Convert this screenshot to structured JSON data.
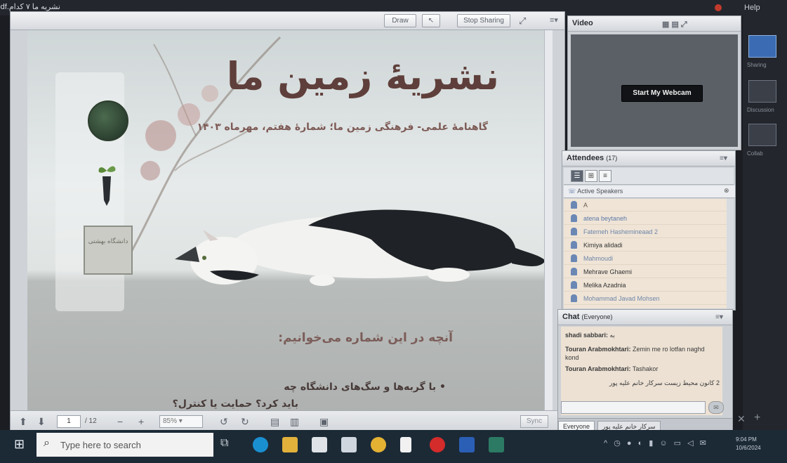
{
  "window": {
    "doc_title": "pdf.نشریه ما ۷ کدام",
    "help": "Help"
  },
  "share": {
    "draw": "Draw",
    "stop_sharing": "Stop Sharing",
    "page_current": "1",
    "page_total": "/ 12",
    "zoom": "85%",
    "sync": "Sync"
  },
  "slide": {
    "title": "نشریهٔ زمین ما",
    "subtitle": "گاهنامهٔ علمی- فرهنگی زمین ما؛ شمارهٔ هفتم، مهرماه ۱۴۰۳",
    "section_heading": "آنچه در این شماره می‌خوانیم:",
    "bullet_line1": "• با گربه‌ها و سگ‌های دانشگاه چه",
    "bullet_line2": "باید کرد؟ حمایت یا کنترل؟",
    "seal_text": "دانشگاه بهشتی"
  },
  "video": {
    "title": "Video",
    "webcam": "Start My Webcam"
  },
  "attendees": {
    "title": "Attendees",
    "count": "(17)",
    "active_speakers": "Active Speakers",
    "list": [
      {
        "name": "A",
        "color": "#6a5a4e"
      },
      {
        "name": "atena beytaneh",
        "color": "#5d7aa8"
      },
      {
        "name": "Fatemeh Hashemineaad 2",
        "color": "#6f86a8"
      },
      {
        "name": "Kimiya alidadi",
        "color": "#333333"
      },
      {
        "name": "Mahmoudi",
        "color": "#6f86a8"
      },
      {
        "name": "Mehrave Ghaemi",
        "color": "#333333"
      },
      {
        "name": "Melika Azadnia",
        "color": "#333333"
      },
      {
        "name": "Mohammad Javad Mohsen",
        "color": "#6f86a8"
      }
    ]
  },
  "chat": {
    "title": "Chat",
    "scope": "(Everyone)",
    "messages": [
      {
        "from": "shadi sabbari:",
        "text": "به"
      },
      {
        "from": "Touran Arabmokhtari:",
        "text": "Zemin me ro lotfan naghd kond"
      },
      {
        "from": "Touran Arabmokhtari:",
        "text": "Tashakor"
      },
      {
        "from": "",
        "text": "2 کانون محیط زیست سرکار خانم علیه پور"
      }
    ],
    "tab_everyone": "Everyone",
    "tab_private": "سرکار خانم علیه پور"
  },
  "rail": {
    "sharing": "Sharing",
    "discussion": "Discussion",
    "collab": "Collab"
  },
  "taskbar": {
    "search_placeholder": "Type here to search",
    "time": "9:04 PM",
    "date": "10/6/2024"
  }
}
